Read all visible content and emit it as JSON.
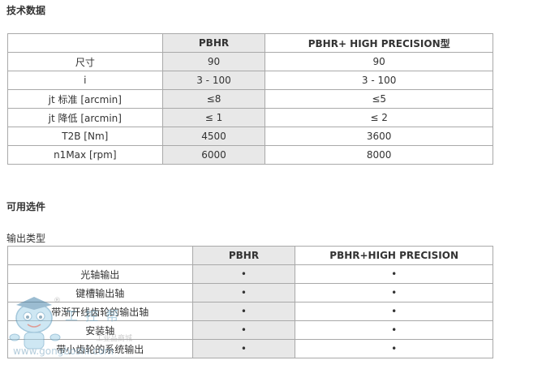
{
  "tech": {
    "title": "技术数据",
    "headers": [
      "",
      "PBHR",
      "PBHR+ HIGH PRECISION型"
    ],
    "rows": [
      [
        "尺寸",
        "90",
        "90"
      ],
      [
        "i",
        "3 - 100",
        "3 - 100"
      ],
      [
        "jt 标准 [arcmin]",
        "≤8",
        "≤5"
      ],
      [
        "jt 降低 [arcmin]",
        "≤ 1",
        "≤ 2"
      ],
      [
        "T2B [Nm]",
        "4500",
        "3600"
      ],
      [
        "n1Max [rpm]",
        "6000",
        "8000"
      ]
    ]
  },
  "options": {
    "title": "可用选件",
    "subtitle": "输出类型",
    "headers": [
      "",
      "PBHR",
      "PBHR+HIGH PRECISION"
    ],
    "rows": [
      [
        "光轴输出",
        "•",
        "•"
      ],
      [
        "键槽输出轴",
        "•",
        "•"
      ],
      [
        "带渐开线齿轮的输出轴",
        "•",
        "•"
      ],
      [
        "安装轴",
        "•",
        "•"
      ],
      [
        "带小齿轮的系统输出",
        "•",
        "•"
      ]
    ]
  },
  "watermark": {
    "text": "工 控 帮",
    "small": "工业品商城",
    "url": "www.gongboshi.com",
    "registered": "®"
  }
}
